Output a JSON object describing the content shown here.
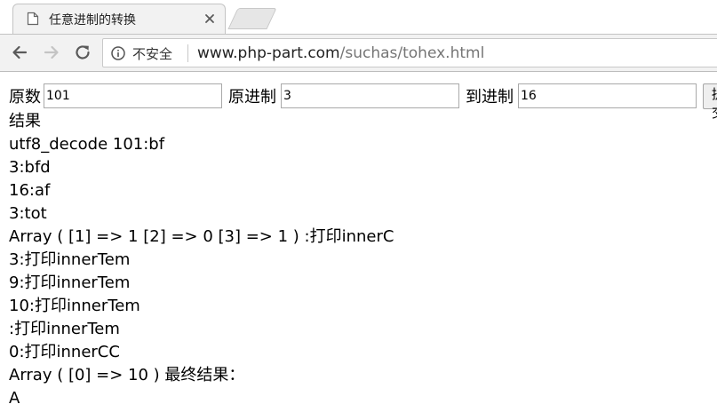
{
  "browser": {
    "tab_title": "任意进制的转换",
    "security_label": "不安全",
    "url_host": "www.php-part.com",
    "url_path": "/suchas/tohex.html"
  },
  "form": {
    "source_label": "原数",
    "source_value": "101",
    "from_base_label": "原进制",
    "from_base_value": "3",
    "to_base_label": "到进制",
    "to_base_value": "16",
    "submit_label": "提交"
  },
  "output": {
    "heading": "结果",
    "lines": [
      "utf8_decode 101:bf",
      "3:bfd",
      "16:af",
      "3:tot",
      "Array ( [1] => 1 [2] => 0 [3] => 1 ) :打印innerC",
      "3:打印innerTem",
      "9:打印innerTem",
      "10:打印innerTem",
      ":打印innerTem",
      "0:打印innerCC",
      "Array ( [0] => 10 ) 最终结果：",
      "A"
    ]
  },
  "icons": {
    "favicon": "document-icon",
    "close": "close-icon",
    "back": "back-arrow-icon",
    "forward": "forward-arrow-icon",
    "reload": "reload-icon",
    "info": "info-icon"
  }
}
